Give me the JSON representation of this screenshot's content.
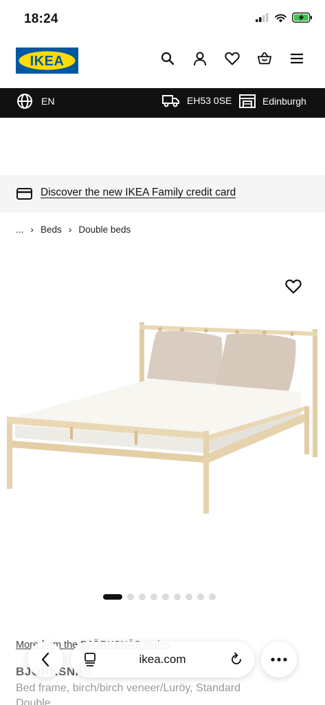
{
  "status_bar": {
    "time": "18:24"
  },
  "header": {
    "logo_text": "IKEA",
    "icons": [
      "search-icon",
      "profile-icon",
      "heart-icon",
      "basket-icon",
      "menu-icon"
    ]
  },
  "location_bar": {
    "language": "EN",
    "postcode": "EH53 0SE",
    "store": "Edinburgh"
  },
  "promo": {
    "text": "Discover the new IKEA Family credit card"
  },
  "breadcrumb": {
    "ellipsis": "...",
    "items": [
      "Beds",
      "Double beds"
    ]
  },
  "carousel": {
    "total": 9,
    "active": 1
  },
  "product": {
    "more_from": "More from the BJÖRKSNÄS series",
    "name": "BJÖRKSNÄS",
    "description": "Bed frame, birch/birch veneer/Luröy, Standard Double"
  },
  "browser": {
    "url": "ikea.com"
  },
  "colors": {
    "ikea_blue": "#0058a3",
    "ikea_yellow": "#ffdb00",
    "birch": "#e9d7b6",
    "cushion": "#d9ccc0"
  }
}
